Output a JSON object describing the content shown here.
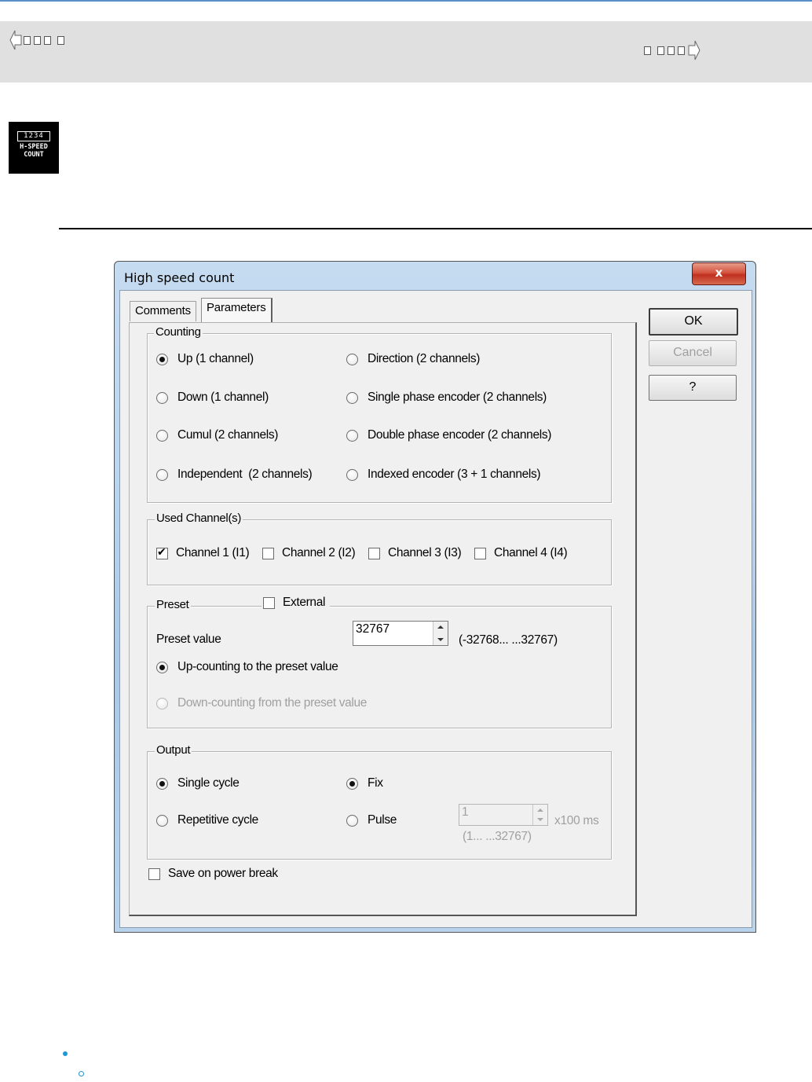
{
  "nav": {
    "prev_label": "▯▯▯ ▯",
    "next_label": "▯ ▯ ▯▯"
  },
  "icon": {
    "digits": "1234",
    "line1": "H-SPEED",
    "line2": "COUNT"
  },
  "dialog": {
    "title": "High speed count",
    "close": "x",
    "tabs": [
      "Comments",
      "Parameters"
    ],
    "buttons": {
      "ok": "OK",
      "cancel": "Cancel",
      "help": "?"
    },
    "counting": {
      "legend": "Counting",
      "options": [
        {
          "label": "Up (1 channel)",
          "selected": true
        },
        {
          "label": "Down (1 channel)",
          "selected": false
        },
        {
          "label": "Cumul (2 channels)",
          "selected": false
        },
        {
          "label": "Independent  (2 channels)",
          "selected": false
        },
        {
          "label": "Direction (2 channels)",
          "selected": false
        },
        {
          "label": "Single phase encoder (2 channels)",
          "selected": false
        },
        {
          "label": "Double phase encoder (2 channels)",
          "selected": false
        },
        {
          "label": "Indexed encoder (3 + 1 channels)",
          "selected": false
        }
      ]
    },
    "channels": {
      "legend": "Used Channel(s)",
      "items": [
        {
          "label": "Channel 1 (I1)",
          "checked": true
        },
        {
          "label": "Channel 2 (I2)",
          "checked": false
        },
        {
          "label": "Channel 3 (I3)",
          "checked": false
        },
        {
          "label": "Channel 4 (I4)",
          "checked": false
        }
      ]
    },
    "preset": {
      "legend": "Preset",
      "external_label": "External",
      "value_label": "Preset value",
      "value": "32767",
      "range": "(-32768... ...32767)",
      "up_label": "Up-counting to the preset value",
      "down_label": "Down-counting from the preset value"
    },
    "output": {
      "legend": "Output",
      "single": "Single cycle",
      "repetitive": "Repetitive cycle",
      "fix": "Fix",
      "pulse": "Pulse",
      "pulse_value": "1",
      "pulse_unit": "x100 ms",
      "pulse_range": "(1... ...32767)"
    },
    "save_label": "Save on power break"
  }
}
